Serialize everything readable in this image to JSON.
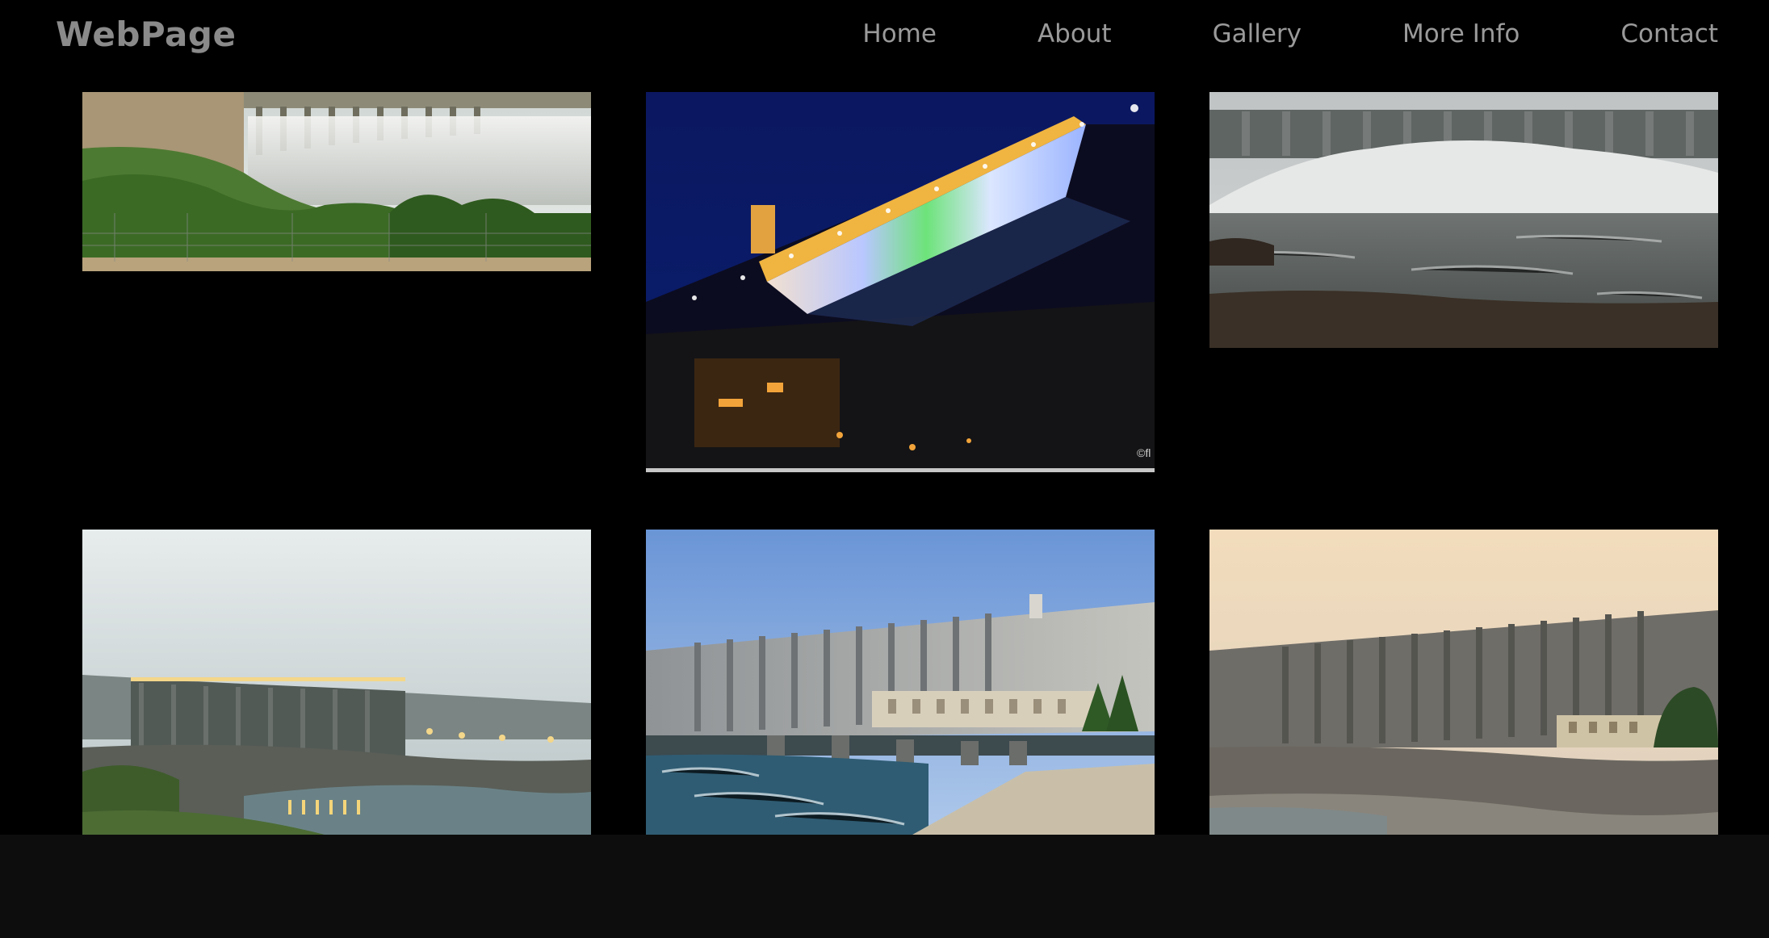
{
  "header": {
    "brand": "WebPage",
    "nav": [
      "Home",
      "About",
      "Gallery",
      "More Info",
      "Contact"
    ]
  },
  "gallery": {
    "images": [
      {
        "subject": "dam-spillway-daytime"
      },
      {
        "subject": "dam-illuminated-night"
      },
      {
        "subject": "dam-spillway-mist"
      },
      {
        "subject": "dam-dusk-lights"
      },
      {
        "subject": "dam-clear-sky"
      },
      {
        "subject": "dam-sunset"
      }
    ],
    "watermark": "©fl"
  },
  "colors": {
    "background": "#000000",
    "footer": "#0d0d0d",
    "brand": "#8a8a8a",
    "nav": "#9a9a9a"
  }
}
